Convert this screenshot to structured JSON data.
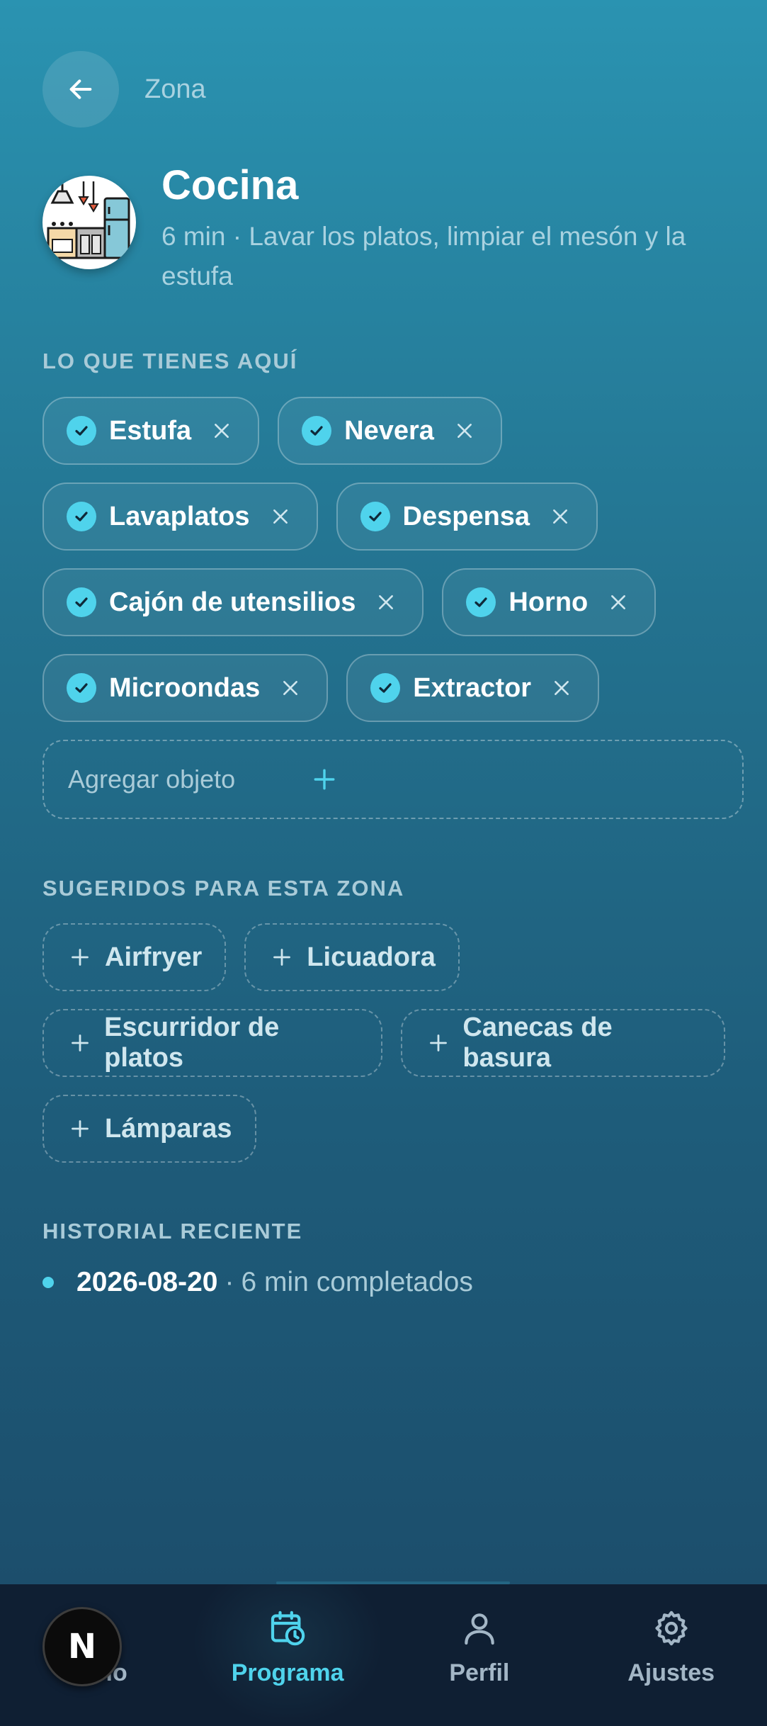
{
  "header": {
    "back_icon": "arrow-left-icon",
    "label": "Zona"
  },
  "zone": {
    "title": "Cocina",
    "subtitle": "6 min · Lavar los platos, limpiar el mesón y la estufa",
    "avatar_icon": "kitchen-illustration-icon"
  },
  "items_section": {
    "title": "LO QUE TIENES AQUÍ",
    "rows": [
      [
        {
          "label": "Estufa"
        },
        {
          "label": "Nevera"
        }
      ],
      [
        {
          "label": "Lavaplatos"
        },
        {
          "label": "Despensa"
        }
      ],
      [
        {
          "label": "Cajón de utensilios"
        },
        {
          "label": "Horno"
        }
      ],
      [
        {
          "label": "Microondas"
        },
        {
          "label": "Extractor"
        }
      ]
    ],
    "add_placeholder": "Agregar objeto"
  },
  "suggested_section": {
    "title": "SUGERIDOS PARA ESTA ZONA",
    "rows": [
      [
        {
          "label": "Airfryer"
        },
        {
          "label": "Licuadora"
        }
      ],
      [
        {
          "label": "Escurridor de platos"
        },
        {
          "label": "Canecas de basura"
        }
      ],
      [
        {
          "label": "Lámparas"
        }
      ]
    ]
  },
  "history_section": {
    "title": "HISTORIAL RECIENTE",
    "entries": [
      {
        "date": "2026-08-20",
        "separator": "·",
        "text": "6 min completados"
      }
    ]
  },
  "bottom_nav": {
    "items": [
      {
        "label": "Inicio",
        "icon": "home-icon"
      },
      {
        "label": "Programa",
        "icon": "calendar-clock-icon",
        "active": true
      },
      {
        "label": "Perfil",
        "icon": "user-icon"
      },
      {
        "label": "Ajustes",
        "icon": "gear-icon"
      }
    ]
  },
  "overlay_badge": {
    "letter": "N"
  },
  "colors": {
    "accent": "#4fd3ec",
    "nav_bg": "#0f1f33",
    "muted_text": "#a9cbd8"
  }
}
